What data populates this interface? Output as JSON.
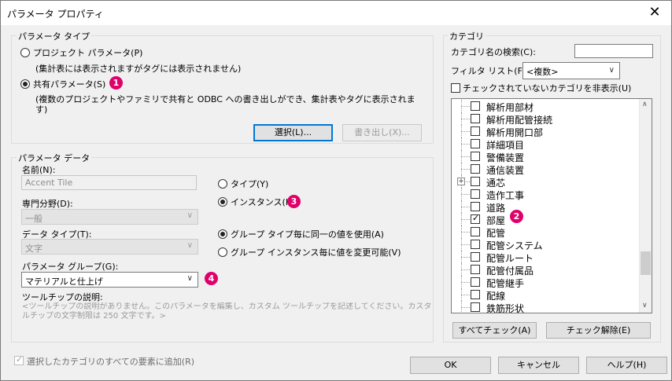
{
  "window": {
    "title": "パラメータ プロパティ"
  },
  "param_type": {
    "legend": "パラメータ タイプ",
    "project_radio": "プロジェクト パラメータ(P)",
    "project_desc": "(集計表には表示されますがタグには表示されません)",
    "shared_radio": "共有パラメータ(S)",
    "shared_desc_1": "(複数のプロジェクトやファミリで共有と ODBC への書き出しができ、集計表やタグに表示されま",
    "shared_desc_2": "す)",
    "select_btn": "選択(L)...",
    "export_btn": "書き出し(X)...",
    "selected": "shared"
  },
  "param_data": {
    "legend": "パラメータ データ",
    "name_label": "名前(N):",
    "name_value": "Accent Tile",
    "discipline_label": "専門分野(D):",
    "discipline_value": "一般",
    "datatype_label": "データ タイプ(T):",
    "datatype_value": "文字",
    "group_label": "パラメータ グループ(G):",
    "group_value": "マテリアルと仕上げ",
    "tooltip_label": "ツールチップの説明:",
    "tooltip_text_1": "<ツールチップの説明がありません。このパラメータを編集し、カスタム ツールチップを記述してください。カスタム ツー",
    "tooltip_text_2": "ルチップの文字制限は 250 文字です。>",
    "type_radio": "タイプ(Y)",
    "instance_radio": "インスタンス(I)",
    "group_same_radio": "グループ タイプ毎に同一の値を使用(A)",
    "group_vary_radio": "グループ インスタンス毎に値を変更可能(V)"
  },
  "category": {
    "legend": "カテゴリ",
    "search_label": "カテゴリ名の検索(C):",
    "search_value": "",
    "filter_label": "フィルタ リスト(F):",
    "filter_value": "<複数>",
    "hide_unchecked": "チェックされていないカテゴリを非表示(U)",
    "items": [
      {
        "label": "解析用部材",
        "checked": false
      },
      {
        "label": "解析用配管接続",
        "checked": false
      },
      {
        "label": "解析用開口部",
        "checked": false
      },
      {
        "label": "詳細項目",
        "checked": false
      },
      {
        "label": "警備装置",
        "checked": false
      },
      {
        "label": "通信装置",
        "checked": false
      },
      {
        "label": "通芯",
        "checked": false,
        "expandable": true
      },
      {
        "label": "造作工事",
        "checked": false
      },
      {
        "label": "道路",
        "checked": false
      },
      {
        "label": "部屋",
        "checked": true
      },
      {
        "label": "配管",
        "checked": false
      },
      {
        "label": "配管システム",
        "checked": false
      },
      {
        "label": "配管ルート",
        "checked": false
      },
      {
        "label": "配管付属品",
        "checked": false
      },
      {
        "label": "配管継手",
        "checked": false
      },
      {
        "label": "配線",
        "checked": false
      },
      {
        "label": "鉄筋形状",
        "checked": false
      }
    ],
    "check_all_btn": "すべてチェック(A)",
    "uncheck_all_btn": "チェック解除(E)"
  },
  "footer": {
    "add_all_label": "選択したカテゴリのすべての要素に追加(R)",
    "ok_btn": "OK",
    "cancel_btn": "キャンセル",
    "help_btn": "ヘルプ(H)"
  },
  "badges": [
    "1",
    "2",
    "3",
    "4"
  ],
  "colors": {
    "badge": "#e0006a",
    "focus": "#0078d7"
  }
}
